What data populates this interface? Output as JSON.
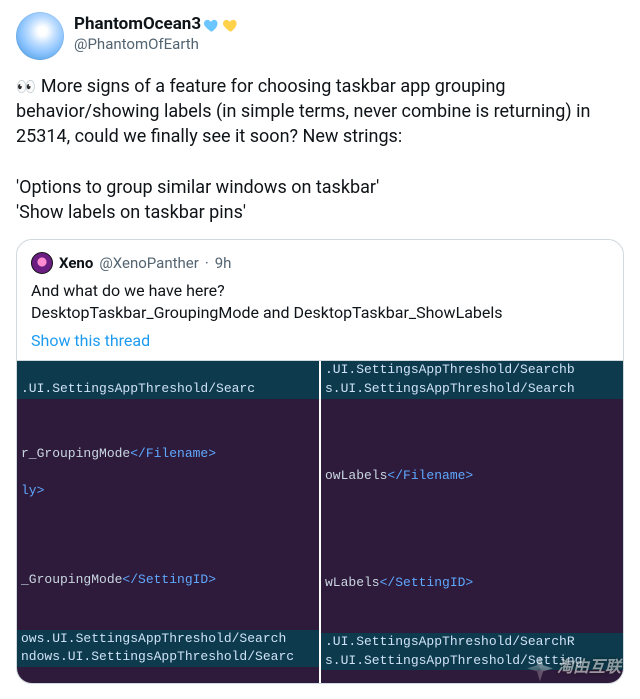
{
  "author": {
    "display_name": "PhantomOcean3",
    "handle": "@PhantomOfEarth",
    "heart_colors": [
      "#6bc5ff",
      "#ffd24a"
    ]
  },
  "tweet": {
    "emoji": "👀",
    "text_line1": "  More signs of a feature for choosing taskbar app grouping behavior/showing labels (in simple terms, never combine is returning) in 25314, could we finally see it soon? New strings:",
    "text_line2": "'Options to group similar windows on taskbar'",
    "text_line3": "'Show labels on taskbar pins'"
  },
  "quoted": {
    "display_name": "Xeno",
    "handle": "@XenoPanther",
    "time": "9h",
    "body": "And what do we have here?\nDesktopTaskbar_GroupingMode and DesktopTaskbar_ShowLabels",
    "thread_link": "Show this thread"
  },
  "code_left": {
    "top1": ".UI.SettingsAppThreshold/Searc",
    "l1a": "r_GroupingMode",
    "l1b": "</Filename>",
    "l2": "ly>",
    "l3a": "_GroupingMode",
    "l3b": "</SettingID>",
    "b1": "ows.UI.SettingsAppThreshold/Search",
    "b2": "ndows.UI.SettingsAppThreshold/Searc"
  },
  "code_right": {
    "top1": ".UI.SettingsAppThreshold/Searchb",
    "top2": "s.UI.SettingsAppThreshold/Search",
    "l1a": "owLabels",
    "l1b": "</Filename>",
    "l3a": "wLabels",
    "l3b": "</SettingID>",
    "b1": ".UI.SettingsAppThreshold/SearchR",
    "b2": "s.UI.SettingsAppThreshold/Setting"
  },
  "watermark": "淘由互联"
}
